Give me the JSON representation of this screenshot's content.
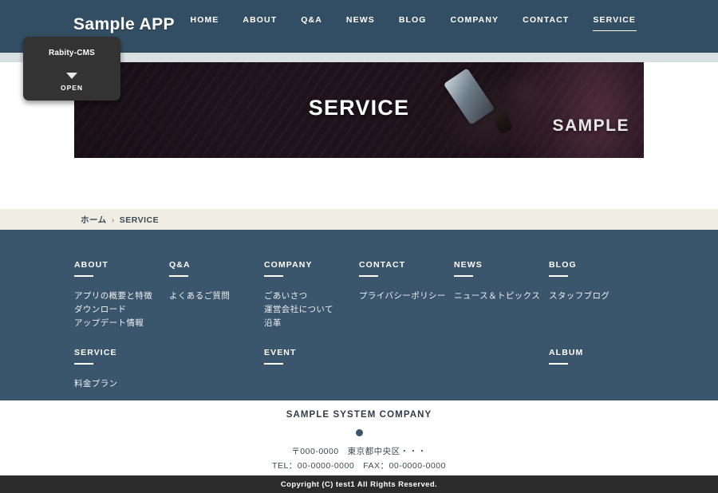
{
  "header": {
    "brand": "Sample APP",
    "nav": [
      {
        "label": "HOME",
        "active": false
      },
      {
        "label": "ABOUT",
        "active": false
      },
      {
        "label": "Q&A",
        "active": false
      },
      {
        "label": "NEWS",
        "active": false
      },
      {
        "label": "BLOG",
        "active": false
      },
      {
        "label": "COMPANY",
        "active": false
      },
      {
        "label": "CONTACT",
        "active": false
      },
      {
        "label": "SERVICE",
        "active": true
      }
    ]
  },
  "cms_badge": {
    "title": "Rabity-CMS",
    "open_label": "OPEN",
    "caret_icon": "triangle-down-icon"
  },
  "hero": {
    "title": "SERVICE",
    "subtitle": "SAMPLE",
    "image_alt": "hands-holding-smartphone-on-escalator"
  },
  "breadcrumb": {
    "home": "ホーム",
    "separator": "›",
    "current": "SERVICE"
  },
  "footer_sitemap": {
    "columns": [
      {
        "title": "ABOUT",
        "links": [
          "アプリの概要と特徴",
          "ダウンロード",
          "アップデート情報"
        ]
      },
      {
        "title": "Q&A",
        "links": [
          "よくあるご質問"
        ]
      },
      {
        "title": "COMPANY",
        "links": [
          "ごあいさつ",
          "運営会社について",
          "沿革"
        ]
      },
      {
        "title": "CONTACT",
        "links": [
          "プライバシーポリシー"
        ]
      },
      {
        "title": "NEWS",
        "links": [
          "ニュース＆トピックス"
        ]
      },
      {
        "title": "BLOG",
        "links": [
          "スタッフブログ"
        ]
      },
      {
        "title": "SERVICE",
        "links": [
          "料金プラン"
        ]
      },
      {
        "title": "",
        "links": []
      },
      {
        "title": "EVENT",
        "links": []
      },
      {
        "title": "",
        "links": []
      },
      {
        "title": "",
        "links": []
      },
      {
        "title": "ALBUM",
        "links": []
      }
    ]
  },
  "company": {
    "name": "SAMPLE SYSTEM COMPANY",
    "address": "〒000-0000　東京都中央区・・・",
    "contact": "TEL：00-0000-0000　FAX：00-0000-0000"
  },
  "copyright": {
    "text": "Copyright (C) test1 All Rights Reserved."
  },
  "colors": {
    "header_bg": "#334e63",
    "footer_bg": "#3a556c",
    "breadcrumb_bg": "#f0ede2",
    "underband": "#d9e0e1",
    "copyright_bg": "#2b2b2b",
    "badge_bg": "#333333"
  }
}
